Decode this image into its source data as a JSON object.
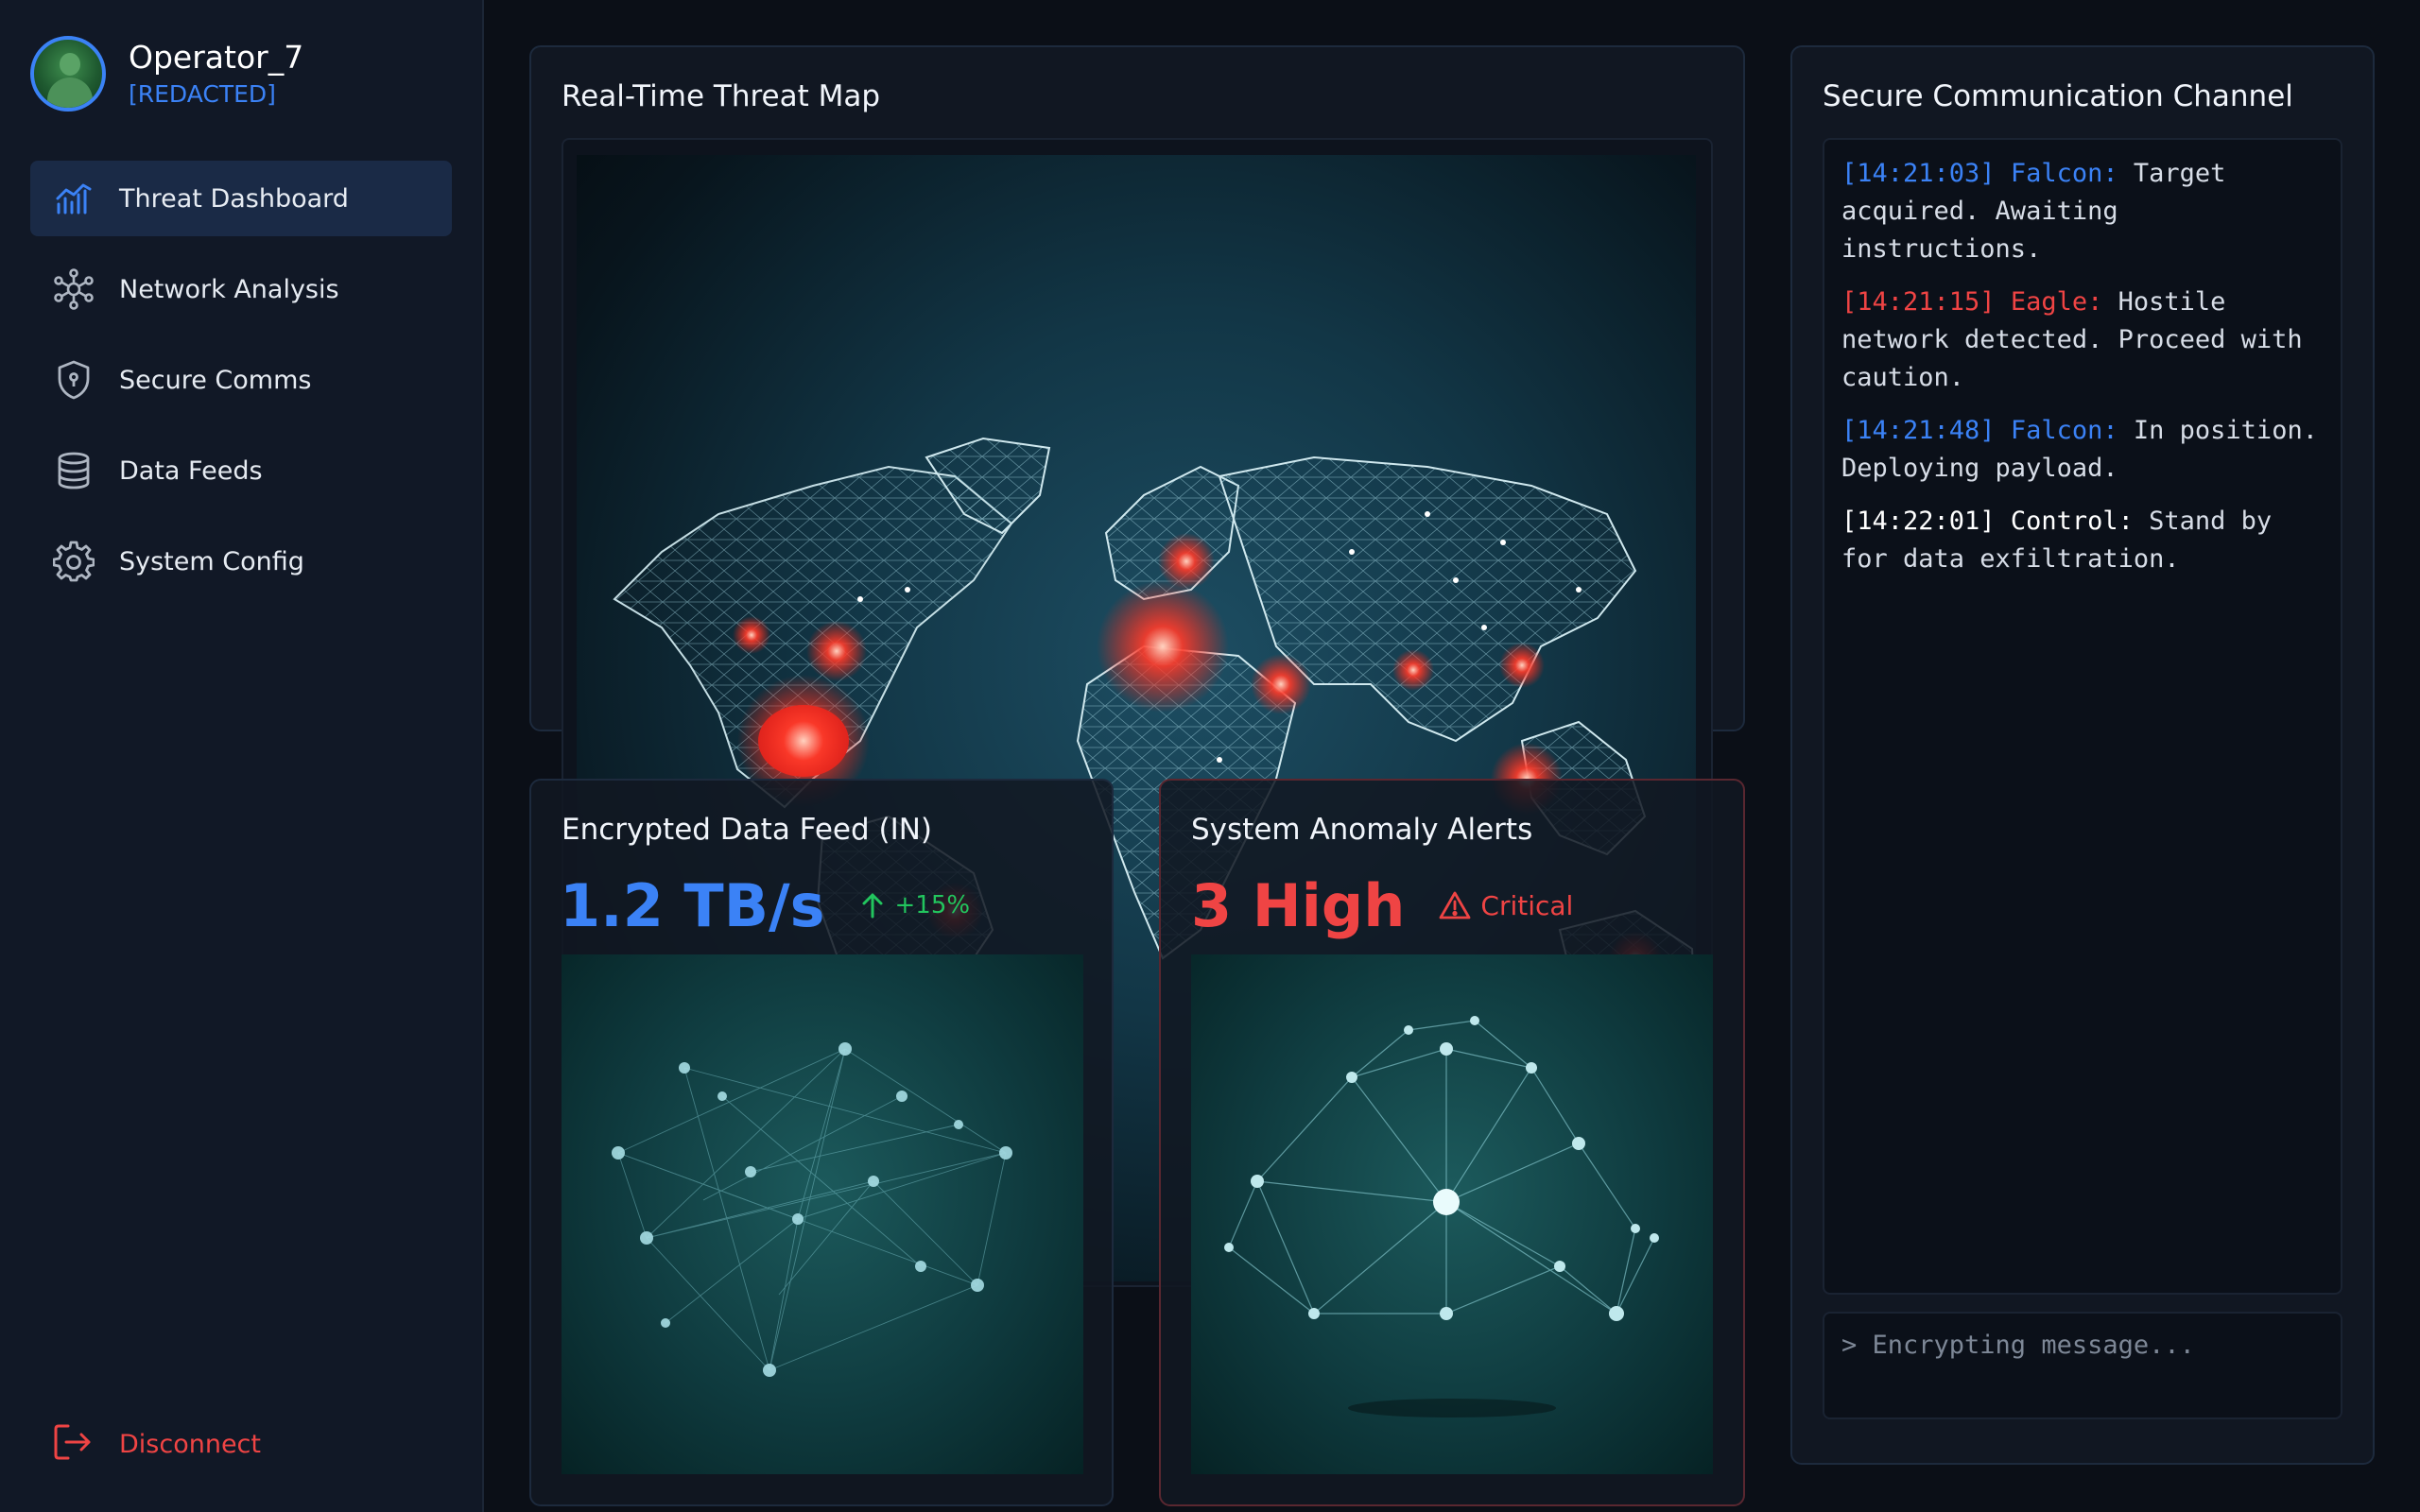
{
  "profile": {
    "name": "Operator_7",
    "role": "[REDACTED]"
  },
  "nav": {
    "items": [
      {
        "label": "Threat Dashboard",
        "icon": "chart-icon",
        "active": true
      },
      {
        "label": "Network Analysis",
        "icon": "network-icon",
        "active": false
      },
      {
        "label": "Secure Comms",
        "icon": "shield-icon",
        "active": false
      },
      {
        "label": "Data Feeds",
        "icon": "database-icon",
        "active": false
      },
      {
        "label": "System Config",
        "icon": "gear-icon",
        "active": false
      }
    ],
    "disconnect_label": "Disconnect"
  },
  "map": {
    "title": "Real-Time Threat Map"
  },
  "feed": {
    "title": "Encrypted Data Feed (IN)",
    "value": "1.2 TB/s",
    "delta": "+15%"
  },
  "alerts": {
    "title": "System Anomaly Alerts",
    "value": "3 High",
    "severity": "Critical"
  },
  "comms": {
    "title": "Secure Communication Channel",
    "log": [
      {
        "ts": "[14:21:03]",
        "sender": "Falcon:",
        "text": "Target acquired. Awaiting instructions.",
        "color": "blue"
      },
      {
        "ts": "[14:21:15]",
        "sender": "Eagle:",
        "text": "Hostile network detected. Proceed with caution.",
        "color": "red"
      },
      {
        "ts": "[14:21:48]",
        "sender": "Falcon:",
        "text": "In position. Deploying payload.",
        "color": "blue"
      },
      {
        "ts": "[14:22:01]",
        "sender": "Control:",
        "text": "Stand by for data exfiltration.",
        "color": "white"
      }
    ],
    "input_placeholder": "> Encrypting message..."
  },
  "colors": {
    "accent": "#3b82f6",
    "danger": "#ef4444",
    "success": "#22c55e",
    "background": "#0b0f17"
  }
}
